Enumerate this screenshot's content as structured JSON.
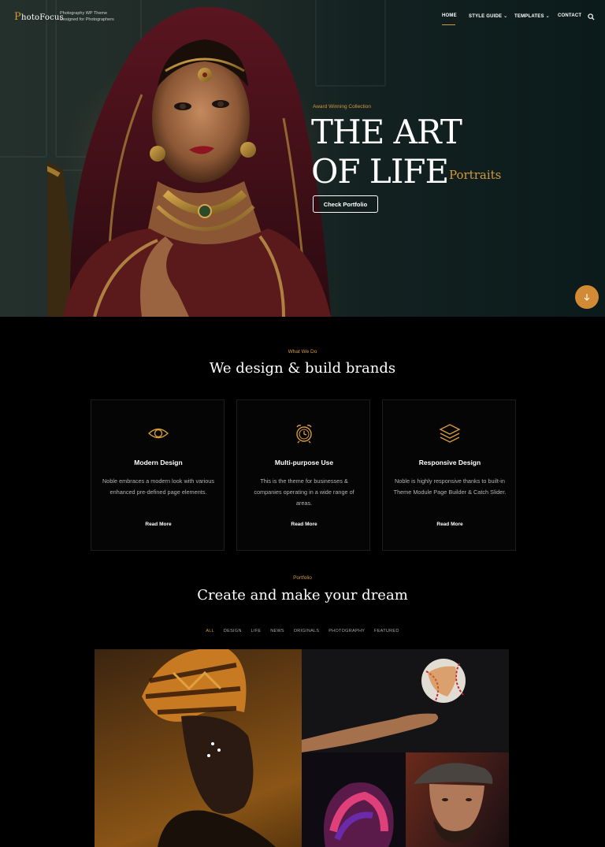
{
  "brand": {
    "logo_first": "P",
    "logo_rest": "hotoFocus",
    "tagline_1": "Photography WP Theme",
    "tagline_2": "Designed for Photographers"
  },
  "nav": {
    "home": "HOME",
    "style_guide": "STYLE GUIDE",
    "templates": "TEMPLATES",
    "contact": "CONTACT",
    "dropdown_glyph": "⌄"
  },
  "hero": {
    "kicker": "Award Winning Collection",
    "title_line1": "THE ART",
    "title_line2": "OF LIFE",
    "subtitle": "Portraits",
    "button": "Check Portfolio"
  },
  "services": {
    "kicker": "What We Do",
    "heading": "We design & build brands",
    "cards": [
      {
        "icon": "eye-icon",
        "title": "Modern Design",
        "text": "Noble embraces a modern look with various enhanced pre-defined page elements.",
        "link": "Read More"
      },
      {
        "icon": "alarm-clock-icon",
        "title": "Multi-purpose Use",
        "text": "This is the theme for businesses & companies operating in a wide range of areas.",
        "link": "Read More"
      },
      {
        "icon": "layers-icon",
        "title": "Responsive Design",
        "text": "Noble is highly responsive thanks to built-in Theme Module Page Builder & Catch Slider.",
        "link": "Read More"
      }
    ]
  },
  "portfolio": {
    "kicker": "Portfolio",
    "heading": "Create and make your dream",
    "filters": [
      "ALL",
      "DESIGN",
      "LIFE",
      "NEWS",
      "ORIGINALS",
      "PHOTOGRAPHY",
      "FEATURED"
    ],
    "active_filter": "ALL"
  },
  "colors": {
    "accent": "#d49a3c",
    "background": "#000000",
    "card_border": "#1d1d1d"
  }
}
